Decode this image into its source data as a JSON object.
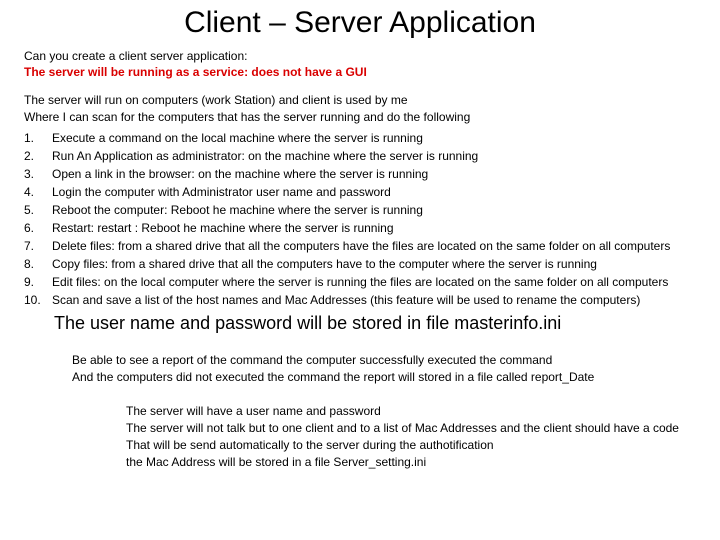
{
  "title": "Client – Server Application",
  "intro": {
    "line1": "Can you create a client server application:",
    "line2": "The server will be running as a service: does not have a GUI"
  },
  "overview": {
    "line1": "The server will run on computers (work Station) and client is used by me",
    "line2": "Where I can scan for the computers that has the server running and do the following"
  },
  "items": [
    {
      "num": "1.",
      "text": "Execute a command on the local machine where the server is running"
    },
    {
      "num": "2.",
      "text": "Run An Application as administrator: on the machine where the server is running"
    },
    {
      "num": "3.",
      "text": "Open a link in the browser: on the machine where the server is running"
    },
    {
      "num": "4.",
      "text": "Login the computer with Administrator user name and password"
    },
    {
      "num": "5.",
      "text": "Reboot the computer: Reboot he machine where the server is running"
    },
    {
      "num": "6.",
      "text": "Restart: restart : Reboot he machine where the server is running"
    },
    {
      "num": "7.",
      "text": "Delete files: from a shared drive that all the computers have the files are located on the same folder on all computers"
    },
    {
      "num": "8.",
      "text": "Copy files:  from a shared drive that all the computers have to the computer where the server is running"
    },
    {
      "num": "9.",
      "text": "Edit files: on the local computer where the server is running the files are located on the same folder on all computers"
    },
    {
      "num": "10.",
      "text": "Scan and save a list of the host names and Mac Addresses (this feature will be used to rename the computers)"
    }
  ],
  "credentials": "The user name and password will be stored in file masterinfo.ini",
  "report": {
    "line1": "Be able to see a report of the command the computer successfully executed the command",
    "line2": "And the computers did not executed the command the report will stored in a file called report_Date"
  },
  "auth": {
    "line1": "The server will have a user name and password",
    "line2": "The server will not talk but to one client and to a list of Mac Addresses and the client should have a code",
    "line3": "That will be send automatically to the server during the authotification",
    "line4": " the Mac Address will be stored in a file Server_setting.ini"
  }
}
